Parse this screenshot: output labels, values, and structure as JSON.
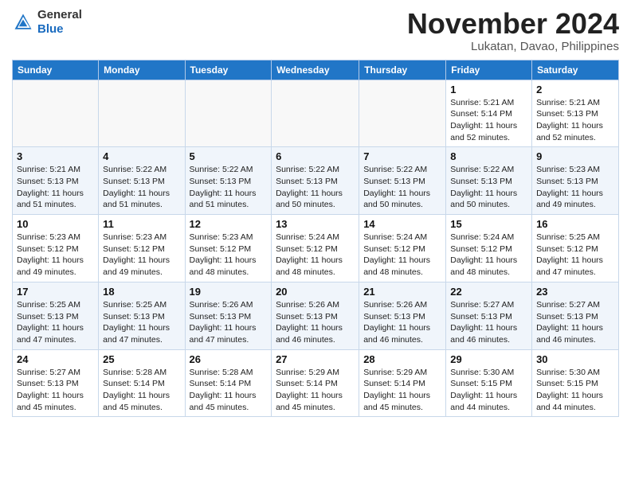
{
  "header": {
    "logo_general": "General",
    "logo_blue": "Blue",
    "month_title": "November 2024",
    "location": "Lukatan, Davao, Philippines"
  },
  "calendar": {
    "days_of_week": [
      "Sunday",
      "Monday",
      "Tuesday",
      "Wednesday",
      "Thursday",
      "Friday",
      "Saturday"
    ],
    "weeks": [
      [
        {
          "day": "",
          "info": ""
        },
        {
          "day": "",
          "info": ""
        },
        {
          "day": "",
          "info": ""
        },
        {
          "day": "",
          "info": ""
        },
        {
          "day": "",
          "info": ""
        },
        {
          "day": "1",
          "info": "Sunrise: 5:21 AM\nSunset: 5:14 PM\nDaylight: 11 hours\nand 52 minutes."
        },
        {
          "day": "2",
          "info": "Sunrise: 5:21 AM\nSunset: 5:13 PM\nDaylight: 11 hours\nand 52 minutes."
        }
      ],
      [
        {
          "day": "3",
          "info": "Sunrise: 5:21 AM\nSunset: 5:13 PM\nDaylight: 11 hours\nand 51 minutes."
        },
        {
          "day": "4",
          "info": "Sunrise: 5:22 AM\nSunset: 5:13 PM\nDaylight: 11 hours\nand 51 minutes."
        },
        {
          "day": "5",
          "info": "Sunrise: 5:22 AM\nSunset: 5:13 PM\nDaylight: 11 hours\nand 51 minutes."
        },
        {
          "day": "6",
          "info": "Sunrise: 5:22 AM\nSunset: 5:13 PM\nDaylight: 11 hours\nand 50 minutes."
        },
        {
          "day": "7",
          "info": "Sunrise: 5:22 AM\nSunset: 5:13 PM\nDaylight: 11 hours\nand 50 minutes."
        },
        {
          "day": "8",
          "info": "Sunrise: 5:22 AM\nSunset: 5:13 PM\nDaylight: 11 hours\nand 50 minutes."
        },
        {
          "day": "9",
          "info": "Sunrise: 5:23 AM\nSunset: 5:13 PM\nDaylight: 11 hours\nand 49 minutes."
        }
      ],
      [
        {
          "day": "10",
          "info": "Sunrise: 5:23 AM\nSunset: 5:12 PM\nDaylight: 11 hours\nand 49 minutes."
        },
        {
          "day": "11",
          "info": "Sunrise: 5:23 AM\nSunset: 5:12 PM\nDaylight: 11 hours\nand 49 minutes."
        },
        {
          "day": "12",
          "info": "Sunrise: 5:23 AM\nSunset: 5:12 PM\nDaylight: 11 hours\nand 48 minutes."
        },
        {
          "day": "13",
          "info": "Sunrise: 5:24 AM\nSunset: 5:12 PM\nDaylight: 11 hours\nand 48 minutes."
        },
        {
          "day": "14",
          "info": "Sunrise: 5:24 AM\nSunset: 5:12 PM\nDaylight: 11 hours\nand 48 minutes."
        },
        {
          "day": "15",
          "info": "Sunrise: 5:24 AM\nSunset: 5:12 PM\nDaylight: 11 hours\nand 48 minutes."
        },
        {
          "day": "16",
          "info": "Sunrise: 5:25 AM\nSunset: 5:12 PM\nDaylight: 11 hours\nand 47 minutes."
        }
      ],
      [
        {
          "day": "17",
          "info": "Sunrise: 5:25 AM\nSunset: 5:13 PM\nDaylight: 11 hours\nand 47 minutes."
        },
        {
          "day": "18",
          "info": "Sunrise: 5:25 AM\nSunset: 5:13 PM\nDaylight: 11 hours\nand 47 minutes."
        },
        {
          "day": "19",
          "info": "Sunrise: 5:26 AM\nSunset: 5:13 PM\nDaylight: 11 hours\nand 47 minutes."
        },
        {
          "day": "20",
          "info": "Sunrise: 5:26 AM\nSunset: 5:13 PM\nDaylight: 11 hours\nand 46 minutes."
        },
        {
          "day": "21",
          "info": "Sunrise: 5:26 AM\nSunset: 5:13 PM\nDaylight: 11 hours\nand 46 minutes."
        },
        {
          "day": "22",
          "info": "Sunrise: 5:27 AM\nSunset: 5:13 PM\nDaylight: 11 hours\nand 46 minutes."
        },
        {
          "day": "23",
          "info": "Sunrise: 5:27 AM\nSunset: 5:13 PM\nDaylight: 11 hours\nand 46 minutes."
        }
      ],
      [
        {
          "day": "24",
          "info": "Sunrise: 5:27 AM\nSunset: 5:13 PM\nDaylight: 11 hours\nand 45 minutes."
        },
        {
          "day": "25",
          "info": "Sunrise: 5:28 AM\nSunset: 5:14 PM\nDaylight: 11 hours\nand 45 minutes."
        },
        {
          "day": "26",
          "info": "Sunrise: 5:28 AM\nSunset: 5:14 PM\nDaylight: 11 hours\nand 45 minutes."
        },
        {
          "day": "27",
          "info": "Sunrise: 5:29 AM\nSunset: 5:14 PM\nDaylight: 11 hours\nand 45 minutes."
        },
        {
          "day": "28",
          "info": "Sunrise: 5:29 AM\nSunset: 5:14 PM\nDaylight: 11 hours\nand 45 minutes."
        },
        {
          "day": "29",
          "info": "Sunrise: 5:30 AM\nSunset: 5:15 PM\nDaylight: 11 hours\nand 44 minutes."
        },
        {
          "day": "30",
          "info": "Sunrise: 5:30 AM\nSunset: 5:15 PM\nDaylight: 11 hours\nand 44 minutes."
        }
      ]
    ]
  }
}
